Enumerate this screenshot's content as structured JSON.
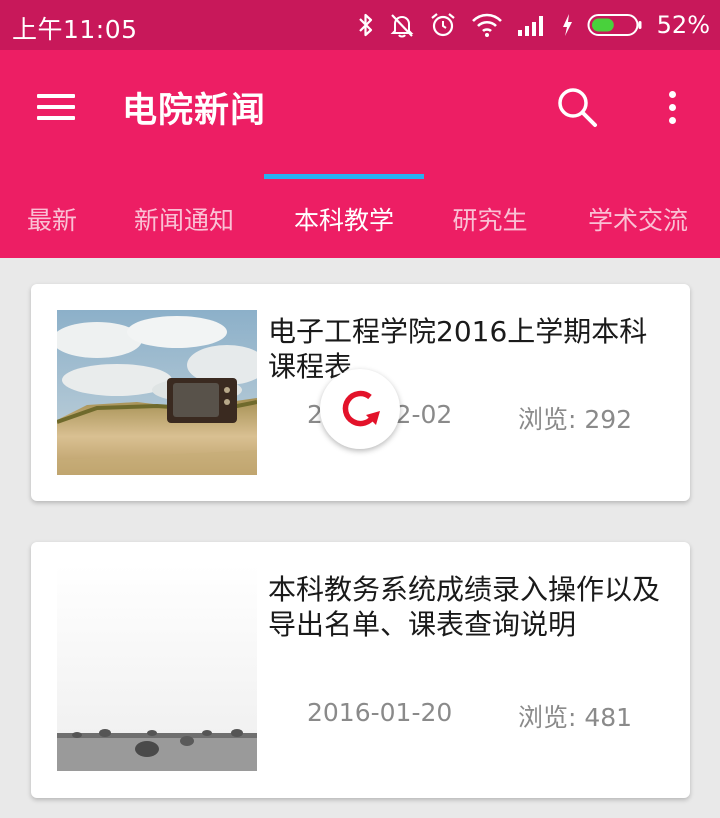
{
  "status_bar": {
    "time": "上午11:05",
    "battery_percent": "52%",
    "battery_level": 0.52,
    "icons": [
      "bluetooth-icon",
      "bell-off-icon",
      "alarm-icon",
      "wifi-icon",
      "signal-icon",
      "charging-icon",
      "battery-icon"
    ]
  },
  "app_bar": {
    "title": "电院新闻",
    "menu_icon": "menu-icon",
    "search_icon": "search-icon",
    "more_icon": "more-vert-icon"
  },
  "tabs": [
    {
      "label": "最新",
      "active": false
    },
    {
      "label": "新闻通知",
      "active": false
    },
    {
      "label": "本科教学",
      "active": true
    },
    {
      "label": "研究生",
      "active": false
    },
    {
      "label": "学术交流",
      "active": false
    }
  ],
  "news": [
    {
      "title": "电子工程学院2016上学期本科课程表",
      "date": "2016-02-02",
      "views": "浏览: 292",
      "thumbnail": "old-tv-on-grass-photo"
    },
    {
      "title": "本科教务系统成绩录入操作以及导出名单、课表查询说明",
      "date": "2016-01-20",
      "views": "浏览: 481",
      "thumbnail": "hay-bales-field-photo"
    }
  ],
  "refresh_indicator": {
    "icon": "refresh-icon",
    "color": "#e3122a"
  },
  "colors": {
    "status_bar": "#c8185a",
    "app_bar": "#ed1e64",
    "tab_indicator": "#27b1f0",
    "background": "#e9e9e9"
  }
}
